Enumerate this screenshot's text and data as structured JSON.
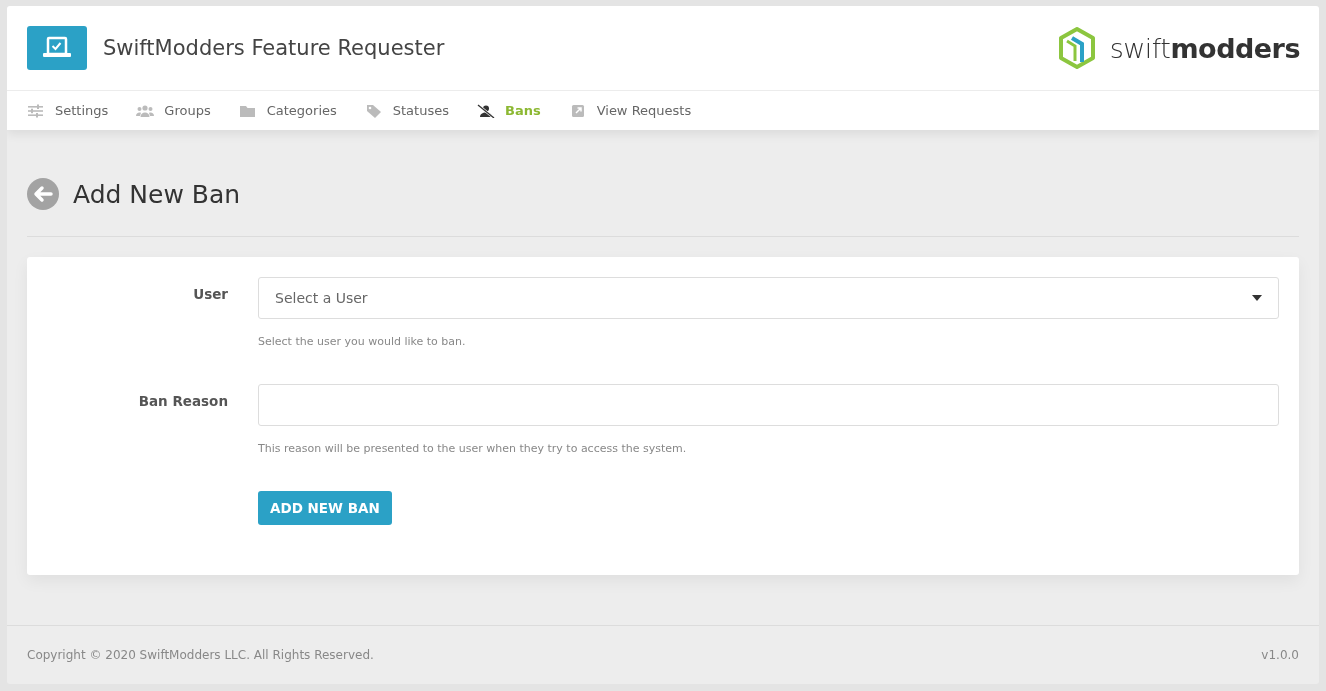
{
  "header": {
    "title": "SwiftModders Feature Requester",
    "brand": "swift**modders**"
  },
  "nav": [
    {
      "label": "Settings",
      "kind": "sliders",
      "selected": false
    },
    {
      "label": "Groups",
      "kind": "users",
      "selected": false
    },
    {
      "label": "Categories",
      "kind": "folder",
      "selected": false
    },
    {
      "label": "Statuses",
      "kind": "tag",
      "selected": false
    },
    {
      "label": "Bans",
      "kind": "user-slash",
      "selected": true
    },
    {
      "label": "View Requests",
      "kind": "external",
      "selected": false
    }
  ],
  "page_title": "Add New Ban",
  "form": {
    "fields": [
      {
        "kind": "select",
        "label": "User",
        "placeholder": "Select a User",
        "help": "Select the user you would like to ban."
      },
      {
        "kind": "text",
        "label": "Ban Reason",
        "help": "This reason will be presented to the user when they try to access the system."
      }
    ],
    "submit": "ADD NEW BAN"
  },
  "footer": {
    "copyright": "Copyright © 2020 SwiftModders LLC. All Rights Reserved.",
    "version": "v1.0.0"
  }
}
